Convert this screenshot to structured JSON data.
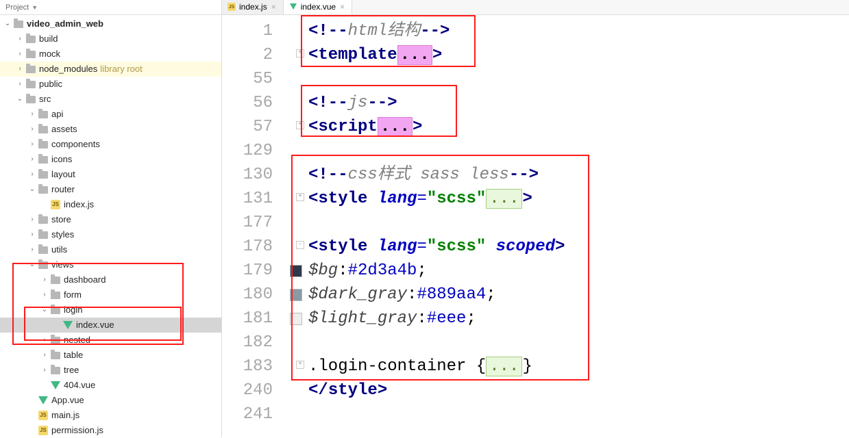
{
  "sidebar": {
    "header": "Project",
    "root": "video_admin_web",
    "items": [
      {
        "label": "build",
        "type": "folder",
        "arrow": ">",
        "indent": 1
      },
      {
        "label": "mock",
        "type": "folder",
        "arrow": ">",
        "indent": 1
      },
      {
        "label": "node_modules",
        "type": "folder",
        "arrow": ">",
        "indent": 1,
        "lib": true,
        "hint": "library root"
      },
      {
        "label": "public",
        "type": "folder",
        "arrow": ">",
        "indent": 1
      },
      {
        "label": "src",
        "type": "folder",
        "arrow": "v",
        "indent": 1
      },
      {
        "label": "api",
        "type": "folder",
        "arrow": ">",
        "indent": 2
      },
      {
        "label": "assets",
        "type": "folder",
        "arrow": ">",
        "indent": 2
      },
      {
        "label": "components",
        "type": "folder",
        "arrow": ">",
        "indent": 2
      },
      {
        "label": "icons",
        "type": "folder",
        "arrow": ">",
        "indent": 2
      },
      {
        "label": "layout",
        "type": "folder",
        "arrow": ">",
        "indent": 2
      },
      {
        "label": "router",
        "type": "folder",
        "arrow": "v",
        "indent": 2
      },
      {
        "label": "index.js",
        "type": "js",
        "arrow": "",
        "indent": 3
      },
      {
        "label": "store",
        "type": "folder",
        "arrow": ">",
        "indent": 2
      },
      {
        "label": "styles",
        "type": "folder",
        "arrow": ">",
        "indent": 2
      },
      {
        "label": "utils",
        "type": "folder",
        "arrow": ">",
        "indent": 2
      },
      {
        "label": "views",
        "type": "folder",
        "arrow": "v",
        "indent": 2
      },
      {
        "label": "dashboard",
        "type": "folder",
        "arrow": ">",
        "indent": 3
      },
      {
        "label": "form",
        "type": "folder",
        "arrow": ">",
        "indent": 3
      },
      {
        "label": "login",
        "type": "folder",
        "arrow": "v",
        "indent": 3
      },
      {
        "label": "index.vue",
        "type": "vue",
        "arrow": "",
        "indent": 4,
        "selected": true
      },
      {
        "label": "nested",
        "type": "folder",
        "arrow": ">",
        "indent": 3
      },
      {
        "label": "table",
        "type": "folder",
        "arrow": ">",
        "indent": 3
      },
      {
        "label": "tree",
        "type": "folder",
        "arrow": ">",
        "indent": 3
      },
      {
        "label": "404.vue",
        "type": "vue",
        "arrow": "",
        "indent": 3
      },
      {
        "label": "App.vue",
        "type": "vue",
        "arrow": "",
        "indent": 2
      },
      {
        "label": "main.js",
        "type": "js",
        "arrow": "",
        "indent": 2
      },
      {
        "label": "permission.js",
        "type": "js",
        "arrow": "",
        "indent": 2
      }
    ]
  },
  "tabs": [
    {
      "label": "index.js",
      "type": "js",
      "active": false
    },
    {
      "label": "index.vue",
      "type": "vue",
      "active": true
    }
  ],
  "code": {
    "lines": [
      {
        "n": "1",
        "swatch": "",
        "html": "<span class='angle'>&lt;!--</span><span class='cm'>html结构</span><span class='angle'>--&gt;</span>"
      },
      {
        "n": "2",
        "swatch": "",
        "fold": "+",
        "html": "<span class='angle'>&lt;</span><span class='tag'>template</span><span class='ellips'>...</span><span class='angle'>&gt;</span>"
      },
      {
        "n": "55",
        "swatch": "",
        "html": ""
      },
      {
        "n": "56",
        "swatch": "",
        "html": "<span class='angle'>&lt;!--</span><span class='cm'>js</span><span class='angle'>--&gt;</span>"
      },
      {
        "n": "57",
        "swatch": "",
        "fold": "+",
        "html": "<span class='angle'>&lt;</span><span class='tag'>script</span><span class='ellips'>...</span><span class='angle'>&gt;</span>"
      },
      {
        "n": "129",
        "swatch": "",
        "html": ""
      },
      {
        "n": "130",
        "swatch": "",
        "html": "<span class='angle'>&lt;!--</span><span class='cm'>css样式 sass less</span><span class='angle'>--&gt;</span>"
      },
      {
        "n": "131",
        "swatch": "",
        "fold": "+",
        "html": "<span class='angle'>&lt;</span><span class='tag'>style</span> <span class='attr attrname'>lang</span><span class='attr'>=</span><span class='str'>\"scss\"</span><span class='ellipsBox'>...</span><span class='angle'>&gt;</span>"
      },
      {
        "n": "177",
        "swatch": "",
        "html": ""
      },
      {
        "n": "178",
        "swatch": "",
        "fold": "-",
        "html": "<span class='angle'>&lt;</span><span class='tag'>style</span> <span class='attr attrname'>lang</span><span class='attr'>=</span><span class='str'>\"scss\"</span> <span class='attr attrname'>scoped</span><span class='angle'>&gt;</span>"
      },
      {
        "n": "179",
        "swatch": "#2d3a4b",
        "html": "<span class='var'>$bg</span>:<span class='hex'>#2d3a4b</span>;"
      },
      {
        "n": "180",
        "swatch": "#889aa4",
        "html": "<span class='var'>$dark_gray</span>:<span class='hex'>#889aa4</span>;"
      },
      {
        "n": "181",
        "swatch": "#eeeeee",
        "html": "<span class='var'>$light_gray</span>:<span class='hex'>#eee</span>;"
      },
      {
        "n": "182",
        "swatch": "",
        "html": ""
      },
      {
        "n": "183",
        "swatch": "",
        "fold": "+",
        "html": "<span class='sel'>.login-container </span><span class='brace'>{</span><span class='ellipsBox'>...</span><span class='brace'>}</span>"
      },
      {
        "n": "240",
        "swatch": "",
        "html": "<span class='angle'>&lt;/</span><span class='tag'>style</span><span class='angle'>&gt;</span>"
      },
      {
        "n": "241",
        "swatch": "",
        "html": ""
      }
    ]
  },
  "colors": {
    "highlight": "#ff1a1a",
    "chart_swatches": [
      "#2d3a4b",
      "#889aa4",
      "#eeeeee"
    ]
  }
}
